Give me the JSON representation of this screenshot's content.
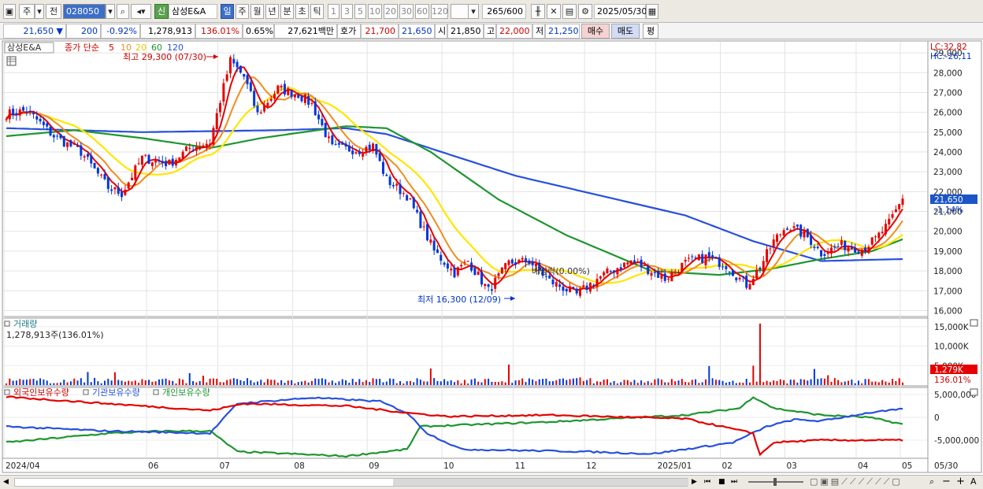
{
  "toolbar": {
    "period_prefix": "주",
    "market": "전",
    "code": "028050",
    "new_badge": "신",
    "stock_name": "삼성E&A",
    "periods": [
      "일",
      "주",
      "월",
      "년",
      "분",
      "초",
      "틱"
    ],
    "selected_period": "일",
    "intervals": [
      "1",
      "3",
      "5",
      "10",
      "20",
      "30",
      "60",
      "120"
    ],
    "count": "265",
    "count_total": "/600",
    "date": "2025/05/30"
  },
  "quote": {
    "price": "21,650",
    "direction": "▼",
    "change": "200",
    "change_pct": "-0.92%",
    "volume": "1,278,913",
    "volume_ratio": "136.01%",
    "turnover": "0.65%",
    "amount": "27,621백만",
    "ask_label": "호가",
    "ask": "21,700",
    "bid": "21,650",
    "open_label": "시",
    "open": "21,850",
    "high_label": "고",
    "high": "22,000",
    "low_label": "저",
    "low": "21,250",
    "buy_label": "매수",
    "sell_label": "매도",
    "flat_label": "평"
  },
  "legend": {
    "name": "삼성E&A",
    "series_label": "종가 단순",
    "ma5": "5",
    "ma10": "10",
    "ma20": "20",
    "ma60": "60",
    "ma120": "120",
    "high_note": "최고 29,300 (07/30)",
    "low_note": "최저 16,300 (12/09)",
    "dividend_note": "배당락(0.00%)",
    "lc": "LC:32,82",
    "hc": "HC:-26,11",
    "cur_price_tag": "21,650",
    "cur_pct_tag": "-1.14%",
    "volume_title": "거래량",
    "volume_value": "1,278,913주(136.01%)",
    "vol_tag": "1,279K",
    "vol_pct_tag": "136.01%",
    "holdings_foreign": "외국인보유수량",
    "holdings_inst": "기관보유수량",
    "holdings_indiv": "개인보유수량"
  },
  "colors": {
    "ma5": "#e60000",
    "ma10": "#f08c1e",
    "ma20": "#ffe600",
    "ma60": "#1e9630",
    "ma120": "#2850dc",
    "up": "#e60000",
    "down": "#0037dc"
  },
  "chart_data": {
    "type": "candlestick",
    "price_axis_ticks": [
      "29,000",
      "28,000",
      "27,000",
      "26,000",
      "25,000",
      "24,000",
      "23,000",
      "22,000",
      "21,000",
      "20,000",
      "19,000",
      "18,000",
      "17,000",
      "16,000"
    ],
    "ylim": [
      15700,
      29600
    ],
    "x_month_labels": [
      "2024/04",
      "06",
      "07",
      "08",
      "09",
      "10",
      "11",
      "12",
      "2025/01",
      "02",
      "03",
      "04",
      "05",
      "05/30"
    ],
    "volume_axis_ticks": [
      "15,000K",
      "10,000K",
      "5,000K"
    ],
    "holdings_axis_ticks": [
      "5,000,000",
      "0",
      "-5,000,000"
    ],
    "close_anchors": [
      [
        0,
        25900
      ],
      [
        6,
        26100
      ],
      [
        14,
        24800
      ],
      [
        22,
        24000
      ],
      [
        30,
        22200
      ],
      [
        34,
        21900
      ],
      [
        40,
        23700
      ],
      [
        48,
        23400
      ],
      [
        54,
        24200
      ],
      [
        60,
        24500
      ],
      [
        63,
        26600
      ],
      [
        66,
        28600
      ],
      [
        70,
        27800
      ],
      [
        74,
        25900
      ],
      [
        80,
        27200
      ],
      [
        86,
        26900
      ],
      [
        90,
        26400
      ],
      [
        96,
        24200
      ],
      [
        104,
        24100
      ],
      [
        108,
        24300
      ],
      [
        112,
        22600
      ],
      [
        118,
        21800
      ],
      [
        126,
        19000
      ],
      [
        132,
        17900
      ],
      [
        136,
        18500
      ],
      [
        142,
        17000
      ],
      [
        148,
        18400
      ],
      [
        154,
        18500
      ],
      [
        160,
        17500
      ],
      [
        168,
        16800
      ],
      [
        174,
        17600
      ],
      [
        178,
        18000
      ],
      [
        184,
        18500
      ],
      [
        190,
        18000
      ],
      [
        194,
        17600
      ],
      [
        200,
        18400
      ],
      [
        206,
        18700
      ],
      [
        212,
        18300
      ],
      [
        216,
        17600
      ],
      [
        218,
        17300
      ],
      [
        222,
        18200
      ],
      [
        226,
        19500
      ],
      [
        230,
        20300
      ],
      [
        236,
        19700
      ],
      [
        240,
        18900
      ],
      [
        246,
        19300
      ],
      [
        252,
        19100
      ],
      [
        256,
        19600
      ],
      [
        260,
        20400
      ],
      [
        264,
        21650
      ]
    ],
    "ma120_anchors": [
      [
        0,
        25200
      ],
      [
        40,
        25000
      ],
      [
        80,
        25100
      ],
      [
        100,
        25200
      ],
      [
        112,
        24900
      ],
      [
        130,
        23900
      ],
      [
        150,
        22800
      ],
      [
        180,
        21600
      ],
      [
        200,
        20800
      ],
      [
        220,
        19500
      ],
      [
        240,
        18500
      ],
      [
        264,
        18600
      ]
    ],
    "ma60_anchors": [
      [
        0,
        24800
      ],
      [
        20,
        25100
      ],
      [
        40,
        24700
      ],
      [
        60,
        24200
      ],
      [
        75,
        24700
      ],
      [
        100,
        25300
      ],
      [
        112,
        25200
      ],
      [
        125,
        24000
      ],
      [
        145,
        21600
      ],
      [
        165,
        19800
      ],
      [
        190,
        18000
      ],
      [
        210,
        17800
      ],
      [
        225,
        18100
      ],
      [
        240,
        18600
      ],
      [
        255,
        19000
      ],
      [
        264,
        19600
      ]
    ],
    "volume_spike_index": 222,
    "volume_spike_k": 15800,
    "volume_typical_k": 1000
  },
  "bottom": {
    "zoom_minus": "−",
    "zoom_plus": "+",
    "text_tool": "A"
  }
}
